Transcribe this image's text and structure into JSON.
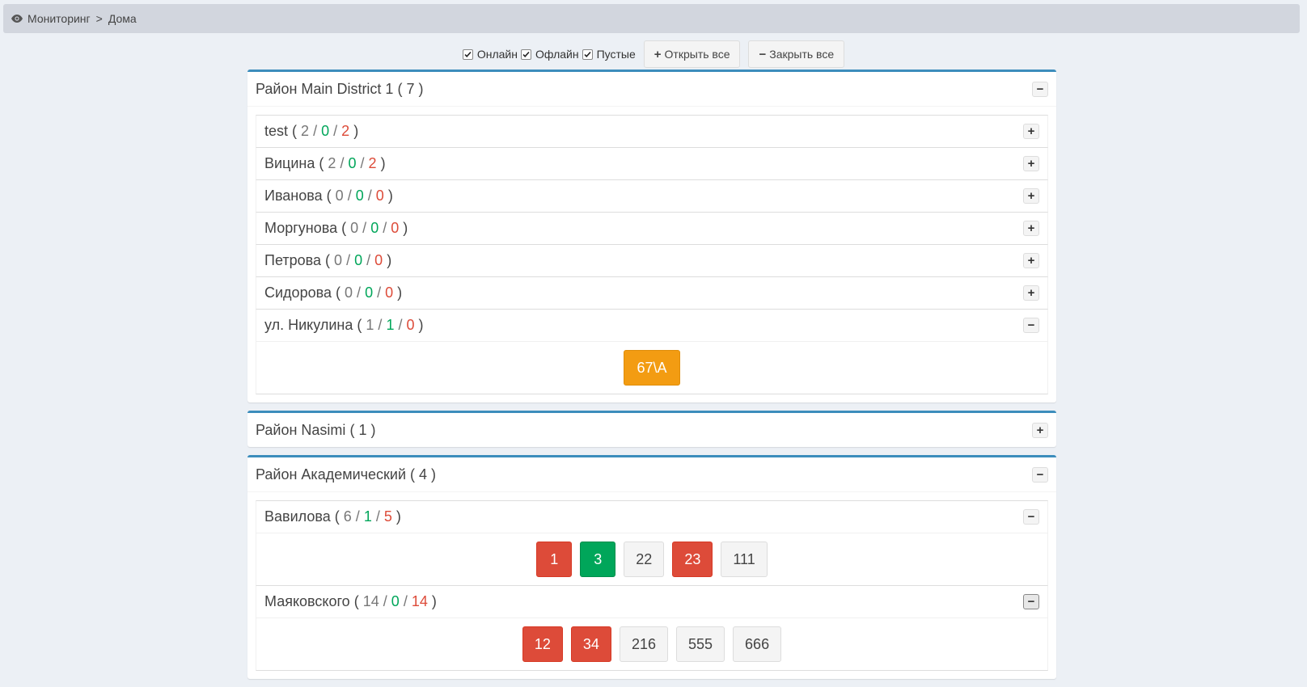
{
  "breadcrumb": {
    "icon": "eye-icon",
    "root": "Мониторинг",
    "separator": ">",
    "current": "Дома"
  },
  "filters": [
    {
      "label": "Онлайн",
      "checked": true
    },
    {
      "label": "Офлайн",
      "checked": true
    },
    {
      "label": "Пустые",
      "checked": true
    }
  ],
  "buttons": {
    "open_all": "Открыть все",
    "open_all_icon": "+",
    "close_all": "Закрыть все",
    "close_all_icon": "−"
  },
  "districts": [
    {
      "name": "Район Main District 1",
      "count": "7",
      "toggle": "−",
      "streets": [
        {
          "name": "test",
          "total": "2",
          "online": "0",
          "offline": "2",
          "toggle": "+",
          "houses": []
        },
        {
          "name": "Вицина",
          "total": "2",
          "online": "0",
          "offline": "2",
          "toggle": "+",
          "houses": []
        },
        {
          "name": "Иванова",
          "total": "0",
          "online": "0",
          "offline": "0",
          "toggle": "+",
          "houses": []
        },
        {
          "name": "Моргунова",
          "total": "0",
          "online": "0",
          "offline": "0",
          "toggle": "+",
          "houses": []
        },
        {
          "name": "Петрова",
          "total": "0",
          "online": "0",
          "offline": "0",
          "toggle": "+",
          "houses": []
        },
        {
          "name": "Сидорова",
          "total": "0",
          "online": "0",
          "offline": "0",
          "toggle": "+",
          "houses": []
        },
        {
          "name": "ул. Никулина",
          "total": "1",
          "online": "1",
          "offline": "0",
          "toggle": "−",
          "houses": [
            {
              "label": "67\\А",
              "status": "warn"
            }
          ]
        }
      ]
    },
    {
      "name": "Район Nasimi",
      "count": "1",
      "toggle": "+",
      "streets": []
    },
    {
      "name": "Район Академический",
      "count": "4",
      "toggle": "−",
      "streets": [
        {
          "name": "Вавилова",
          "total": "6",
          "online": "1",
          "offline": "5",
          "toggle": "−",
          "houses": [
            {
              "label": "1",
              "status": "offline"
            },
            {
              "label": "3",
              "status": "online"
            },
            {
              "label": "22",
              "status": "empty"
            },
            {
              "label": "23",
              "status": "offline"
            },
            {
              "label": "111",
              "status": "empty"
            }
          ]
        },
        {
          "name": "Маяковского",
          "total": "14",
          "online": "0",
          "offline": "14",
          "toggle": "−",
          "houses": [
            {
              "label": "12",
              "status": "offline"
            },
            {
              "label": "34",
              "status": "offline"
            },
            {
              "label": "216",
              "status": "empty"
            },
            {
              "label": "555",
              "status": "empty"
            },
            {
              "label": "666",
              "status": "empty"
            }
          ]
        }
      ]
    }
  ],
  "colors": {
    "accent": "#3c8dbc",
    "online": "#00a65a",
    "offline": "#dd4b39",
    "warning": "#f39c12"
  }
}
